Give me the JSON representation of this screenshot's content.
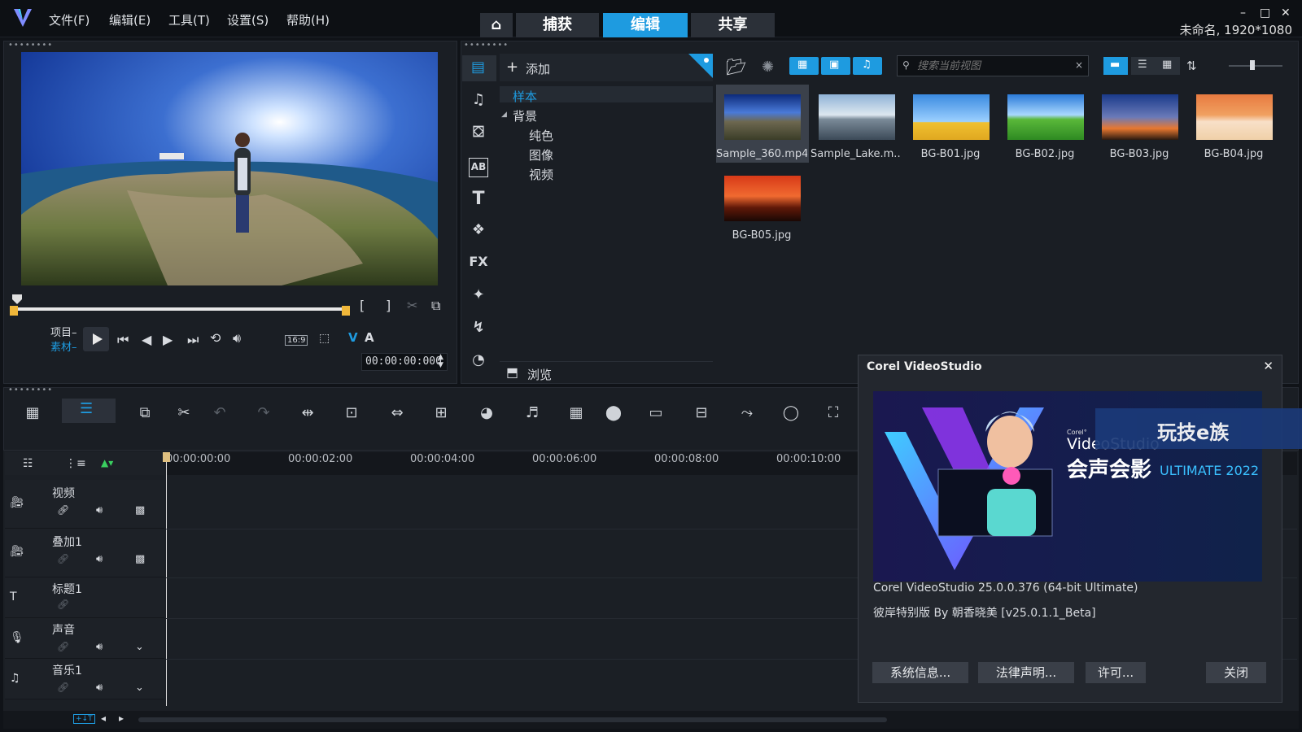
{
  "titlebar": {
    "menu": [
      "文件(F)",
      "编辑(E)",
      "工具(T)",
      "设置(S)",
      "帮助(H)"
    ],
    "mode_tabs": {
      "capture": "捕获",
      "edit": "编辑",
      "share": "共享"
    },
    "project_info": "未命名, 1920*1080",
    "window_controls": {
      "minimize": "–",
      "maximize": "□",
      "close": "✕"
    }
  },
  "preview": {
    "mark_in": "[",
    "mark_out": "]",
    "mode_project": "项目–",
    "mode_clip": "素材–",
    "aspect": "16:9",
    "va": {
      "v": "V",
      "a": "A"
    },
    "timecode": "00:00:00:000"
  },
  "library": {
    "add_label": "添加",
    "search_placeholder": "搜索当前视图",
    "tree": {
      "sample": "样本",
      "background": "背景",
      "solid": "纯色",
      "image": "图像",
      "video": "视频"
    },
    "browse_label": "浏览",
    "items": [
      {
        "name": "Sample_360.mp4",
        "selected": true
      },
      {
        "name": "Sample_Lake.m..."
      },
      {
        "name": "BG-B01.jpg"
      },
      {
        "name": "BG-B02.jpg"
      },
      {
        "name": "BG-B03.jpg"
      },
      {
        "name": "BG-B04.jpg"
      },
      {
        "name": "BG-B05.jpg"
      }
    ],
    "side_labels": {
      "text_ab": "AB",
      "title_t": "T",
      "fx": "FX"
    }
  },
  "timeline": {
    "ruler": [
      "00:00:00:00",
      "00:00:02:00",
      "00:00:04:00",
      "00:00:06:00",
      "00:00:08:00",
      "00:00:10:00"
    ],
    "tracks": [
      {
        "name": "视频"
      },
      {
        "name": "叠加1"
      },
      {
        "name": "标题1"
      },
      {
        "name": "声音"
      },
      {
        "name": "音乐1"
      }
    ]
  },
  "dialog": {
    "title": "Corel VideoStudio",
    "version_line": "Corel VideoStudio 25.0.0.376  (64-bit Ultimate)",
    "edition_line": "彼岸特别版 By 朝香晓美 [v25.0.1.1_Beta]",
    "buttons": {
      "sysinfo": "系统信息...",
      "legal": "法律声明...",
      "license": "许可...",
      "close": "关闭"
    },
    "banner": {
      "corel_small": "Corel°",
      "brand_en": "VideoStudio",
      "brand_cn": "会声会影",
      "edition": "ULTIMATE 2022",
      "watermark": "玩技e族"
    }
  },
  "colors": {
    "accent": "#1e9be0",
    "panel": "#1a1e24",
    "background": "#101318"
  }
}
